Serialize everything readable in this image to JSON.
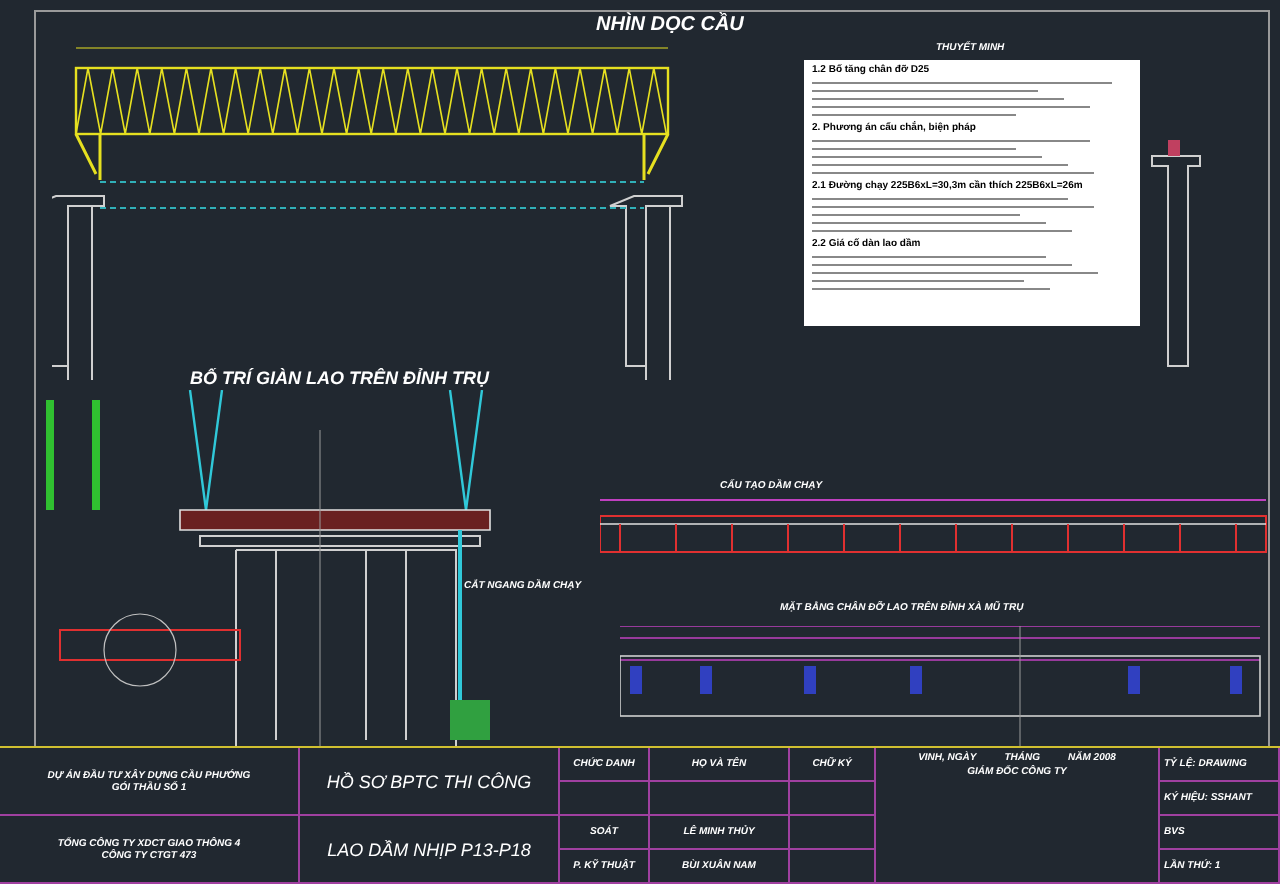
{
  "elevation_title": "NHÌN DỌC CẦU",
  "notes": {
    "heading": "THUYẾT MINH",
    "lines": [
      "1.2 Bố tăng chân đỡ D25",
      "2. Phương án cẩu chắn, biện pháp",
      "2.1 Đường chạy 225B6xL=30,3m cần thích 225B6xL=26m",
      "2.2 Giá cố dàn lao dầm"
    ]
  },
  "section_title": "BỐ TRÍ GIÀN LAO TRÊN ĐỈNH TRỤ",
  "detail_labels": [
    "CẮT NGANG DẦM CHẠY",
    "CẤU TẠO DẦM CHẠY",
    "MẶT BẰNG CHÂN ĐỠ LAO TRÊN ĐỈNH XÀ MŨ TRỤ"
  ],
  "title_block": {
    "project": [
      "DỰ ÁN ĐẦU TƯ XÂY DỰNG CẦU PHƯỚNG",
      "GÓI THẦU SỐ 1"
    ],
    "contractor": [
      "TỔNG CÔNG TY XDCT GIAO THÔNG 4",
      "CÔNG TY CTGT 473"
    ],
    "document": {
      "heading": "HỒ SƠ BPTC THI CÔNG",
      "title": "LAO DẦM NHỊP P13-P18"
    },
    "signature_columns": [
      "CHỨC DANH",
      "HỌ VÀ TÊN",
      "CHỮ KÝ"
    ],
    "signature_rows": [
      {
        "role": "SOÁT",
        "name": "LÊ MINH THỦY"
      },
      {
        "role": "P. KỸ THUẬT",
        "name": "BÙI XUÂN NAM"
      }
    ],
    "date_parts": [
      "VINH, NGÀY",
      "THÁNG",
      "NĂM 2008"
    ],
    "approver": "GIÁM ĐỐC CÔNG TY",
    "info": [
      "TỶ LỆ: DRAWING",
      "KÝ HIỆU: SSHANT",
      "BVS",
      "LẦN THỨ: 1"
    ]
  }
}
